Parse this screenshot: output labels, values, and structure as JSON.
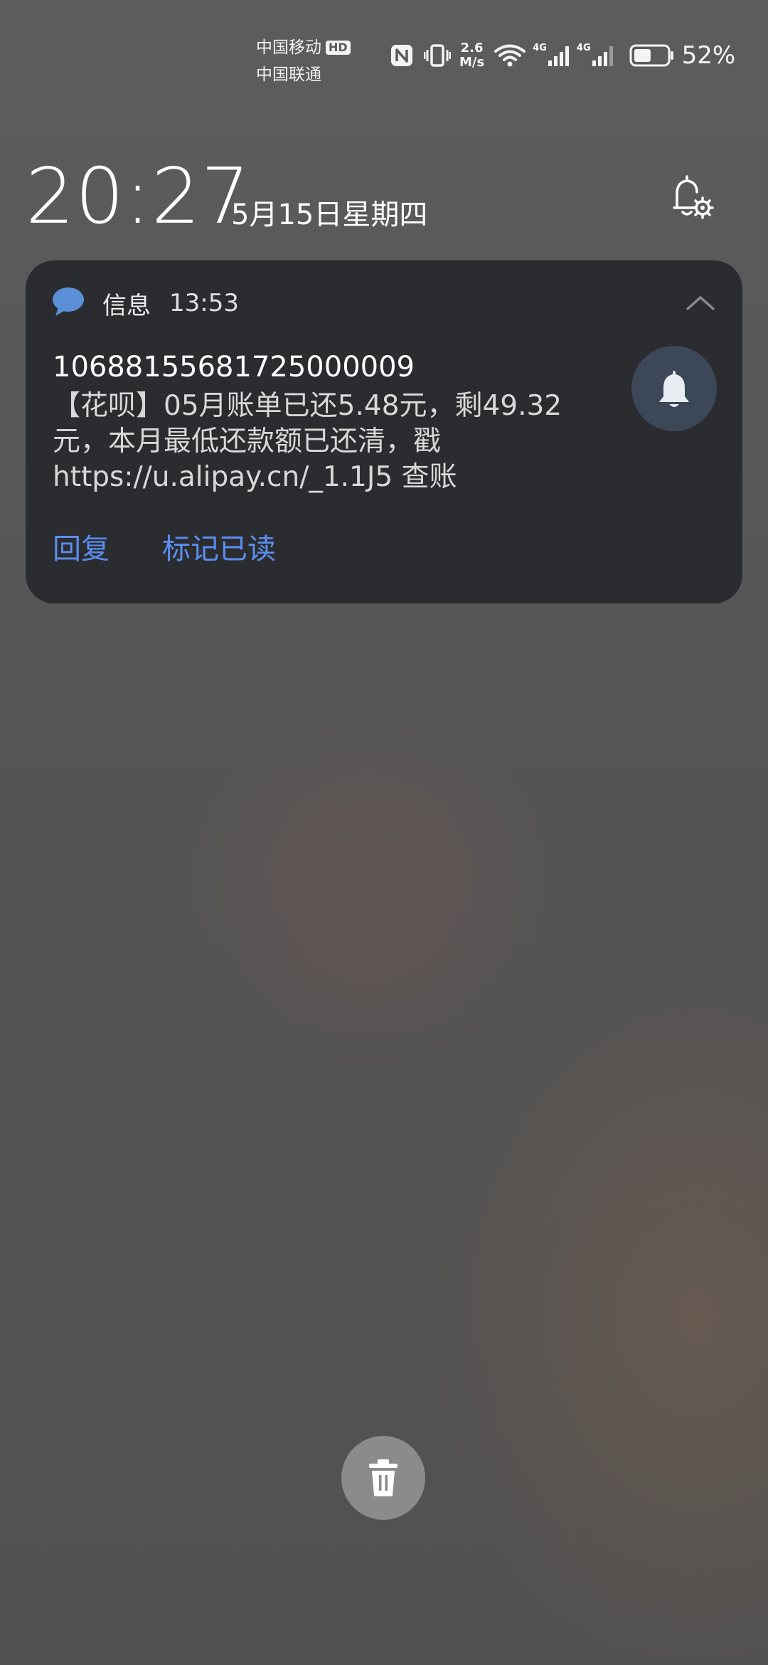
{
  "status_bar": {
    "carrier_1": "中国移动",
    "carrier_1_badge": "HD",
    "carrier_2": "中国联通",
    "net_speed_value": "2.6",
    "net_speed_unit": "M/s",
    "sim1_type": "4G",
    "sim2_type": "4G",
    "battery_percent": "52%",
    "battery_level": 0.52,
    "icons": [
      "nfc-icon",
      "vibrate-icon",
      "wifi-icon",
      "signal-icon",
      "signal-icon",
      "battery-icon"
    ]
  },
  "lockscreen": {
    "time": "20:27",
    "date": "5月15日星期四",
    "settings_icon": "bell-settings-icon"
  },
  "notification": {
    "app_icon": "message-bubble-icon",
    "app_name": "信息",
    "time": "13:53",
    "sender": "10688155681725000009",
    "body": "【花呗】05月账单已还5.48元，剩49.32元，本月最低还款额已还清，戳https://u.alipay.cn/_1.1J5 查账",
    "actions": [
      "回复",
      "标记已读"
    ],
    "accent_color": "#5b8ef0"
  },
  "trash_icon": "trash-icon"
}
